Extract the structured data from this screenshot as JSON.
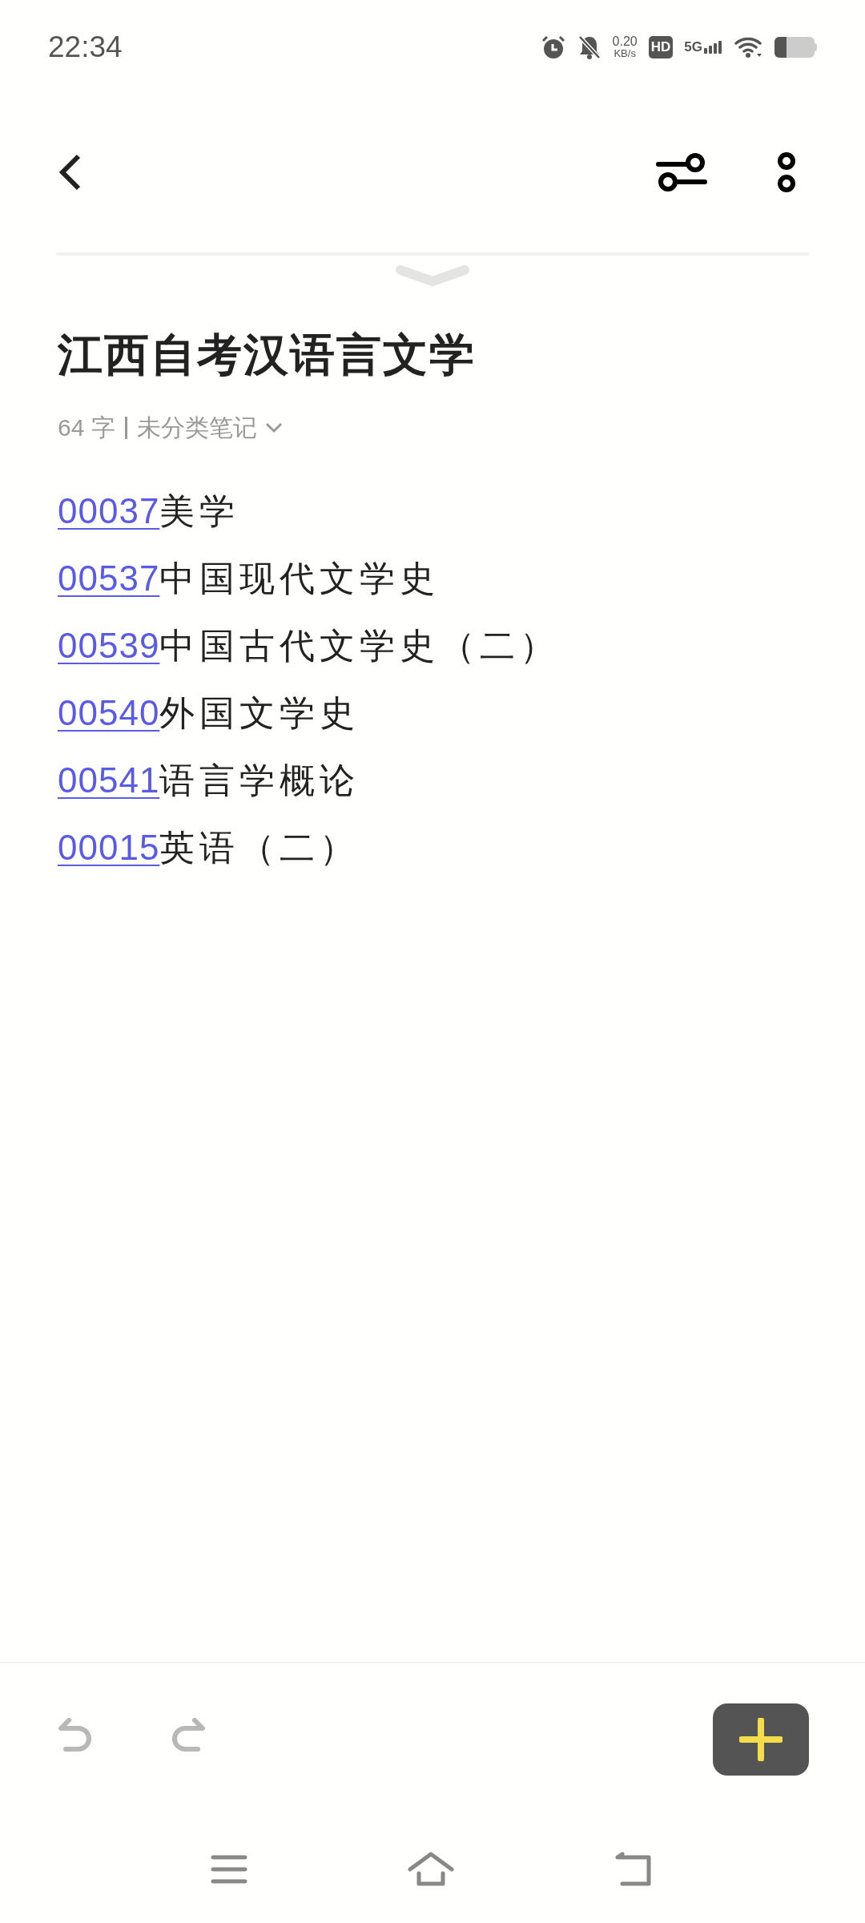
{
  "status_bar": {
    "time": "22:34",
    "net_speed": "0.20",
    "net_unit": "KB/s",
    "hd": "HD",
    "network": "5G"
  },
  "note": {
    "title": "江西自考汉语言文学",
    "word_count": "64 字",
    "category": "未分类笔记",
    "lines": [
      {
        "code": "00037",
        "text": "美学"
      },
      {
        "code": "00537",
        "text": "中国现代文学史"
      },
      {
        "code": "00539",
        "text": "中国古代文学史（二）"
      },
      {
        "code": "00540",
        "text": "外国文学史"
      },
      {
        "code": "00541",
        "text": "语言学概论"
      },
      {
        "code": "00015",
        "text": "英语（二）"
      }
    ]
  },
  "toolbar": {
    "undo_disabled": true,
    "redo_disabled": true
  }
}
